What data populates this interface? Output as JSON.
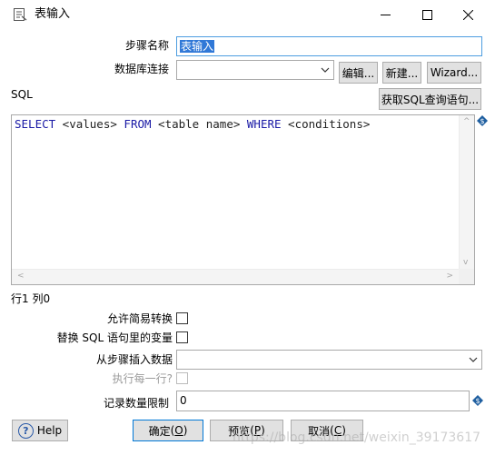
{
  "window": {
    "title": "表输入",
    "minimize_icon": "minimize-icon",
    "maximize_icon": "maximize-icon",
    "close_icon": "close-icon"
  },
  "form": {
    "step_name_label": "步骤名称",
    "step_name_value": "表输入",
    "db_connection_label": "数据库连接",
    "db_connection_value": "",
    "edit_button": "编辑...",
    "new_button": "新建...",
    "wizard_button": "Wizard...",
    "sql_label": "SQL",
    "get_sql_button": "获取SQL查询语句...",
    "sql_query": {
      "kw_select": "SELECT",
      "values": " <values> ",
      "kw_from": "FROM",
      "table_name": " <table name> ",
      "kw_where": "WHERE",
      "conditions": " <conditions>"
    },
    "cursor_position": "行1 列0",
    "allow_lazy_conversion_label": "允许简易转换",
    "replace_variables_label": "替换 SQL 语句里的变量",
    "insert_data_from_step_label": "从步骤插入数据",
    "insert_data_from_step_value": "",
    "execute_each_row_label": "执行每一行?",
    "limit_size_label": "记录数量限制",
    "limit_size_value": "0"
  },
  "footer": {
    "help_button": "Help",
    "ok_button": "确定",
    "ok_shortcut": "O",
    "preview_button": "预览",
    "preview_shortcut": "P",
    "cancel_button": "取消",
    "cancel_shortcut": "C"
  },
  "watermark": "https://blog.csdn.net/weixin_39173617",
  "colors": {
    "sql_keyword": "#1a1aa6",
    "selection": "#3078d7",
    "focus_border": "#4d9de0",
    "variable_icon": "#1f5fa0"
  }
}
